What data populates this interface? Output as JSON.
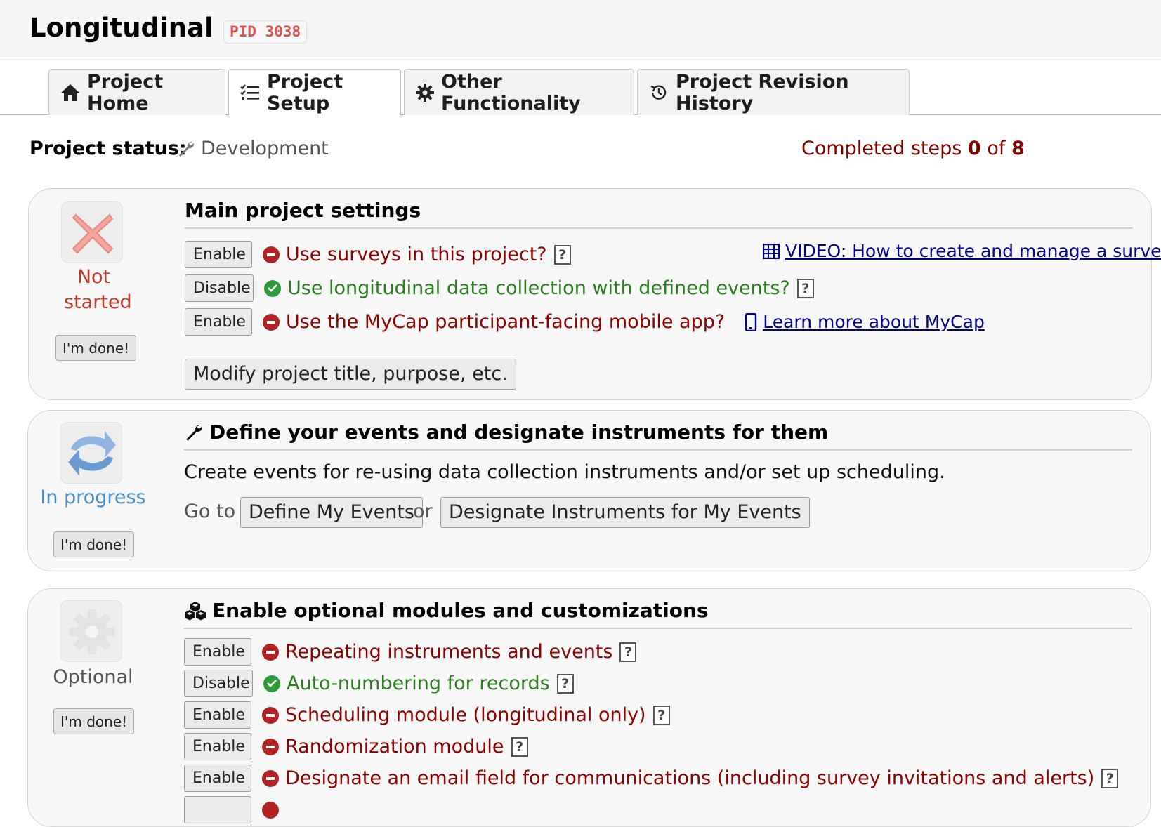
{
  "header": {
    "title": "Longitudinal",
    "pid": "PID 3038"
  },
  "tabs": [
    {
      "label": "Project Home",
      "icon": "home-icon"
    },
    {
      "label": "Project Setup",
      "icon": "checklist-icon"
    },
    {
      "label": "Other Functionality",
      "icon": "gear-icon"
    },
    {
      "label": "Project Revision History",
      "icon": "history-icon"
    }
  ],
  "status": {
    "label": "Project status:",
    "value": "Development",
    "completed_prefix": "Completed steps",
    "completed_count": "0",
    "of": "of",
    "completed_total": "8"
  },
  "panels": {
    "main": {
      "title": "Main project settings",
      "status": "Not started",
      "done_label": "I'm done!",
      "options": [
        {
          "button": "Enable",
          "text": "Use surveys in this project?",
          "enabled": false
        },
        {
          "button": "Disable",
          "text": "Use longitudinal data collection with defined events?",
          "enabled": true
        },
        {
          "button": "Enable",
          "text": "Use the MyCap participant-facing mobile app?",
          "enabled": false
        }
      ],
      "video_link": "VIDEO: How to create and manage a survey",
      "mycap_link": "Learn more about MyCap",
      "modify_label": "Modify project title, purpose, etc."
    },
    "events": {
      "title": "Define your events and designate instruments for them",
      "status": "In progress",
      "done_label": "I'm done!",
      "description": "Create events for re-using data collection instruments and/or set up scheduling.",
      "goto": "Go to",
      "define_label": "Define My Events",
      "or": "or",
      "designate_label": "Designate Instruments for My Events"
    },
    "optional": {
      "title": "Enable optional modules and customizations",
      "status": "Optional",
      "done_label": "I'm done!",
      "options": [
        {
          "button": "Enable",
          "text": "Repeating instruments and events",
          "enabled": false
        },
        {
          "button": "Disable",
          "text": "Auto-numbering for records",
          "enabled": true
        },
        {
          "button": "Enable",
          "text": "Scheduling module (longitudinal only)",
          "enabled": false
        },
        {
          "button": "Enable",
          "text": "Randomization module",
          "enabled": false
        },
        {
          "button": "Enable",
          "text": "Designate an email field for communications (including survey invitations and alerts)",
          "enabled": false
        }
      ]
    }
  },
  "colors": {
    "not_started": "#c0392b",
    "in_progress": "#4a90c2",
    "enabled": "#2a7d1e",
    "disabled": "#8b0000"
  }
}
